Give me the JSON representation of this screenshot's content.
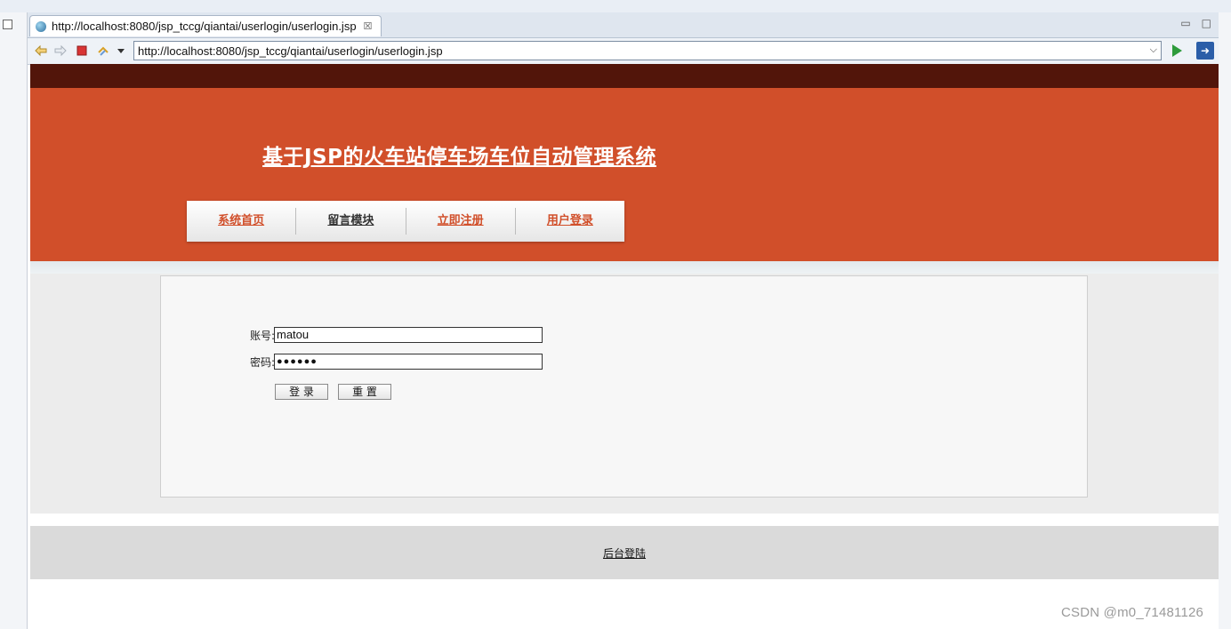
{
  "browser": {
    "tab_title": "http://localhost:8080/jsp_tccg/qiantai/userlogin/userlogin.jsp",
    "tab_close": "☒",
    "url": "http://localhost:8080/jsp_tccg/qiantai/userlogin/userlogin.jsp",
    "icons": [
      "back-icon",
      "forward-icon",
      "stop-icon",
      "refresh-icon",
      "dropdown-icon",
      "go-icon",
      "open-external-icon"
    ]
  },
  "site": {
    "title": "基于JSP的火车站停车场车位自动管理系统",
    "menu": [
      {
        "label": "系统首页"
      },
      {
        "label": "留言模块"
      },
      {
        "label": "立即注册"
      },
      {
        "label": "用户登录"
      }
    ]
  },
  "login": {
    "account_label": "账号:",
    "account_value": "matou",
    "password_label": "密码:",
    "password_value": "●●●●●●",
    "login_button": "登 录",
    "reset_button": "重 置"
  },
  "footer": {
    "admin_link": "后台登陆"
  },
  "watermark": "CSDN @m0_71481126",
  "colors": {
    "topbar": "#52150a",
    "header": "#d14f2a",
    "footer": "#dadada"
  }
}
